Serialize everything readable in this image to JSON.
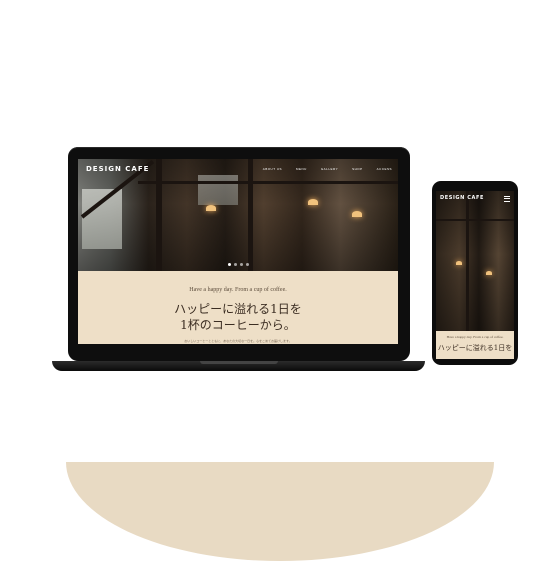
{
  "laptop": {
    "brand": "DESIGN CAFE",
    "nav": [
      "ABOUT US",
      "MENU",
      "GALLERY",
      "SHOP",
      "ACCESS"
    ],
    "tagline": "Have a happy day. From a cup of coffee.",
    "catch_line1": "ハッピーに溢れる1日を",
    "catch_line2": "1杯のコーヒーから。",
    "body_text": "おいしいコーヒーとともに、あなたの大切な一日を。心をこめてお届けします。"
  },
  "phone": {
    "brand": "DESIGN CAFE",
    "tagline": "Have a happy day. From a cup of coffee.",
    "catch_line1": "ハッピーに溢れる1日を"
  },
  "colors": {
    "accent_beige": "#e8dac3",
    "section_beige": "#eedfc7",
    "device_black": "#0e0e0e"
  },
  "icons": {
    "menu": "hamburger-menu-icon"
  }
}
